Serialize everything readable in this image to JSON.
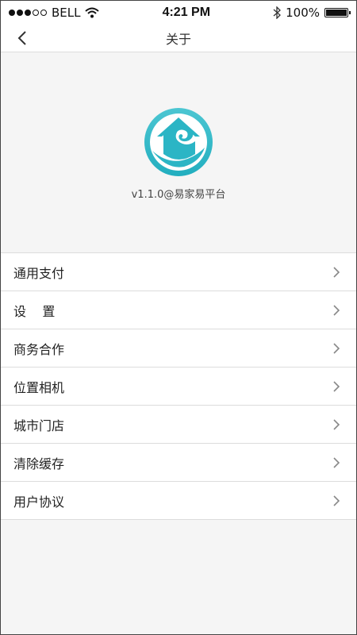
{
  "status_bar": {
    "carrier": "BELL",
    "time": "4:21 PM",
    "battery": "100%"
  },
  "nav": {
    "title": "关于"
  },
  "about": {
    "version": "v1.1.0@易家易平台"
  },
  "menu": {
    "items": [
      {
        "label": "通用支付"
      },
      {
        "label": "设    置"
      },
      {
        "label": "商务合作"
      },
      {
        "label": "位置相机"
      },
      {
        "label": "城市门店"
      },
      {
        "label": "清除缓存"
      },
      {
        "label": "用户协议"
      }
    ]
  },
  "colors": {
    "logo_teal": "#2bb5c5",
    "divider": "#dcdcdc",
    "background": "#f5f5f5"
  }
}
